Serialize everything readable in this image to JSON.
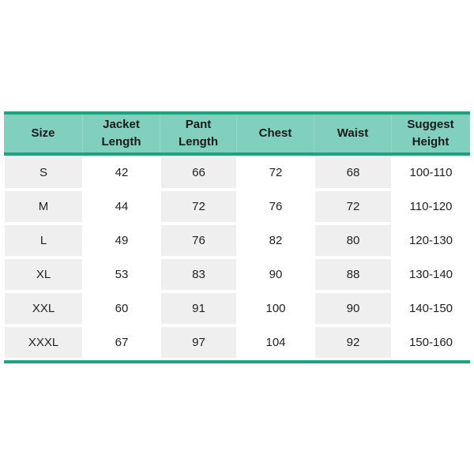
{
  "table": {
    "headers": [
      "Size",
      "Jacket\nLength",
      "Pant\nLength",
      "Chest",
      "Waist",
      "Suggest\nHeight"
    ],
    "rows": [
      [
        "S",
        "42",
        "66",
        "72",
        "68",
        "100-110"
      ],
      [
        "M",
        "44",
        "72",
        "76",
        "72",
        "110-120"
      ],
      [
        "L",
        "49",
        "76",
        "82",
        "80",
        "120-130"
      ],
      [
        "XL",
        "53",
        "83",
        "90",
        "88",
        "130-140"
      ],
      [
        "XXL",
        "60",
        "91",
        "100",
        "90",
        "140-150"
      ],
      [
        "XXXL",
        "67",
        "97",
        "104",
        "92",
        "150-160"
      ]
    ],
    "colors": {
      "header_bg": "#80d0bd",
      "rule": "#1fa37f",
      "shaded_cell": "#efefef"
    }
  }
}
